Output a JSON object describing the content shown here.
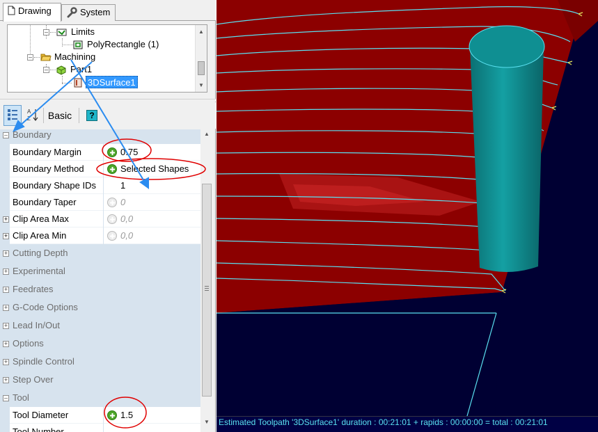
{
  "tabs": {
    "drawing": "Drawing",
    "system": "System"
  },
  "tree": {
    "limits": "Limits",
    "poly_rectangle": "PolyRectangle (1)",
    "machining": "Machining",
    "part1": "Part1",
    "surface": "3DSurface1"
  },
  "toolbar": {
    "basic_label": "Basic",
    "help_label": "?"
  },
  "properties": {
    "boundary_category": "Boundary",
    "boundary_margin": {
      "label": "Boundary Margin",
      "value": "0.75"
    },
    "boundary_method": {
      "label": "Boundary Method",
      "value": "Selected Shapes"
    },
    "boundary_shape_ids": {
      "label": "Boundary Shape IDs",
      "value": "1"
    },
    "boundary_taper": {
      "label": "Boundary Taper",
      "value": "0"
    },
    "clip_area_max": {
      "label": "Clip Area Max",
      "value": "0,0"
    },
    "clip_area_min": {
      "label": "Clip Area Min",
      "value": "0,0"
    },
    "categories": [
      "Cutting Depth",
      "Experimental",
      "Feedrates",
      "G-Code Options",
      "Lead In/Out",
      "Options",
      "Spindle Control",
      "Step Over",
      "Tool"
    ],
    "tool_diameter": {
      "label": "Tool Diameter",
      "value": "1.5"
    },
    "tool_number_partial": "Tool Number"
  },
  "status": {
    "text": "Estimated Toolpath '3DSurface1' duration : 00:21:01 + rapids : 00:00:00 = total : 00:21:01"
  },
  "colors": {
    "surface": "#8c0000",
    "tool": "#0e8a8c",
    "toolpath": "#5ae0f0",
    "background": "#000033",
    "annotation_red": "#e00000",
    "annotation_blue": "#2b8cf0",
    "selection": "#3399ff"
  },
  "icons": [
    "document-icon",
    "wrench-icon",
    "folder-icon",
    "part-icon",
    "limits-icon",
    "rectangle-icon",
    "surface-icon",
    "categorized-icon",
    "alphabetical-icon",
    "help-icon",
    "apply-icon"
  ]
}
